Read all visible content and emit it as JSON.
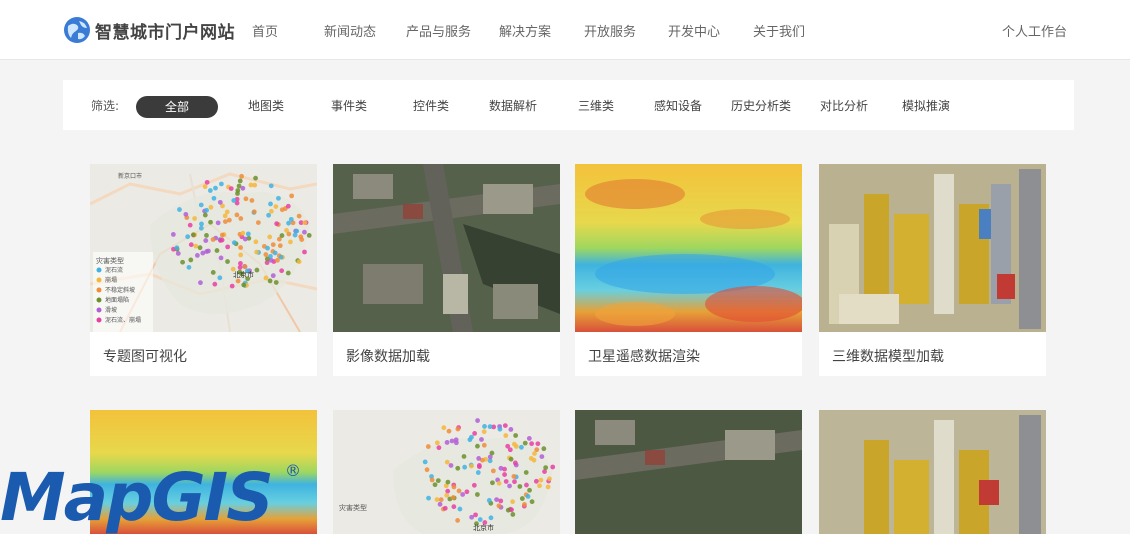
{
  "header": {
    "site_title": "智慧城市门户网站",
    "nav": [
      "首页",
      "新闻动态",
      "产品与服务",
      "解决方案",
      "开放服务",
      "开发中心",
      "关于我们"
    ],
    "workspace": "个人工作台"
  },
  "filter": {
    "label": "筛选:",
    "options": [
      "全部",
      "地图类",
      "事件类",
      "控件类",
      "数据解析",
      "三维类",
      "感知设备",
      "历史分析类",
      "对比分析",
      "模拟推演"
    ],
    "active": "全部"
  },
  "cards": [
    {
      "title": "专题图可视化",
      "thumb": "map"
    },
    {
      "title": "影像数据加载",
      "thumb": "satellite"
    },
    {
      "title": "卫星遥感数据渲染",
      "thumb": "heatmap"
    },
    {
      "title": "三维数据模型加载",
      "thumb": "3d-city"
    }
  ],
  "cards_row2": [
    {
      "thumb": "heatmap"
    },
    {
      "thumb": "map"
    },
    {
      "thumb": "satellite"
    },
    {
      "thumb": "3d-city"
    }
  ],
  "map_legend": {
    "title": "灾害类型",
    "items": [
      {
        "label": "泥石流",
        "color": "#3fb1e3"
      },
      {
        "label": "崩塌",
        "color": "#f5b73b"
      },
      {
        "label": "不稳定斜坡",
        "color": "#f08c3a"
      },
      {
        "label": "地面塌陷",
        "color": "#6a8f2c"
      },
      {
        "label": "滑坡",
        "color": "#b25ed6"
      },
      {
        "label": "泥石流、崩塌",
        "color": "#e83fa3"
      }
    ],
    "place_labels": [
      "北京市",
      "新京口市",
      "北京市"
    ]
  },
  "watermark": {
    "text": "MapGIS",
    "registered": "®"
  }
}
